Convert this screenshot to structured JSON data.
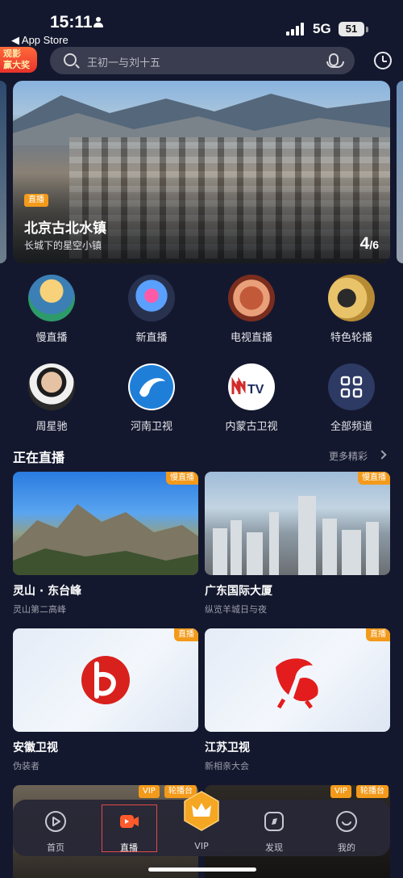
{
  "status_bar": {
    "time": "15:11",
    "back_app": "◀ App Store",
    "network": "5G",
    "battery": "51"
  },
  "promo": {
    "line1": "观影",
    "line2": "赢大奖"
  },
  "search": {
    "placeholder": "王初一与刘十五"
  },
  "banner": {
    "badge": "直播",
    "title": "北京古北水镇",
    "subtitle": "长城下的星空小镇",
    "page_current": "4",
    "page_total": "/6"
  },
  "channels": [
    {
      "label": "慢直播",
      "icon": "slow-live-icon"
    },
    {
      "label": "新直播",
      "icon": "new-live-icon"
    },
    {
      "label": "电视直播",
      "icon": "tv-live-icon"
    },
    {
      "label": "特色轮播",
      "icon": "film-reel-icon"
    },
    {
      "label": "周星驰",
      "icon": "person-avatar-icon"
    },
    {
      "label": "河南卫视",
      "icon": "henan-tv-logo"
    },
    {
      "label": "内蒙古卫视",
      "icon": "nmtv-logo"
    },
    {
      "label": "全部频道",
      "icon": "grid-icon"
    }
  ],
  "section": {
    "title": "正在直播",
    "more": "更多精彩"
  },
  "cards": [
    {
      "title": "灵山 · 东台峰",
      "subtitle": "灵山第二高峰",
      "tag": "慢直播"
    },
    {
      "title": "广东国际大厦",
      "subtitle": "纵览羊城日与夜",
      "tag": "慢直播"
    },
    {
      "title": "安徽卫视",
      "subtitle": "伪装者",
      "tag": "直播"
    },
    {
      "title": "江苏卫视",
      "subtitle": "新相亲大会",
      "tag": "直播"
    }
  ],
  "peek_tags": [
    "VIP",
    "轮播台",
    "VIP",
    "轮播台"
  ],
  "nav": [
    {
      "label": "首页",
      "icon": "play-circle-icon"
    },
    {
      "label": "直播",
      "icon": "live-camera-icon"
    },
    {
      "label": "VIP",
      "icon": "crown-icon"
    },
    {
      "label": "发现",
      "icon": "discover-icon"
    },
    {
      "label": "我的",
      "icon": "smile-face-icon"
    }
  ],
  "colors": {
    "background": "#14182e",
    "accent": "#f39a1b",
    "selected_nav": "#ff5a2c"
  }
}
